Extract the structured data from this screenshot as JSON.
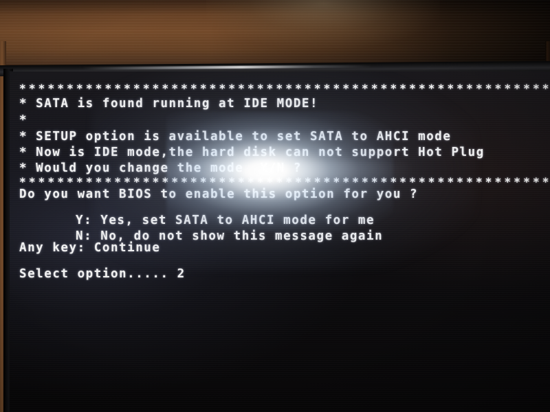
{
  "photo": {
    "subject": "monitor-bios-screen",
    "background_wall_color": "#6d4527",
    "bezel_color": "#1a1a1c",
    "screen_bg_color": "#0b0a0c",
    "text_color": "#f2f2f2",
    "glare_note": "bright lens flare obscures part of three text lines"
  },
  "bios": {
    "rule_top": "*********************************************************************",
    "lines": [
      {
        "id": "line-sata-mode",
        "text": "* SATA is found running at IDE MODE!"
      },
      {
        "id": "line-blank-star",
        "text": "*"
      },
      {
        "id": "line-setup",
        "text": "* SETUP option is available to set SATA to AHCI mode"
      },
      {
        "id": "line-hotplug",
        "text": "* Now is IDE mode,the hard disk can not support Hot Plug"
      },
      {
        "id": "line-change",
        "text": "* Would you change the mode  Y/N ?"
      }
    ],
    "rule_bottom": "*********************************************************************",
    "question": "Do you want BIOS to enable this option for you ?",
    "options": [
      {
        "key": "Y",
        "text": "Y: Yes, set SATA to AHCI mode for me"
      },
      {
        "key": "N",
        "text": "N: No, do not show this message again"
      },
      {
        "key": "Any key",
        "text": "Any key: Continue"
      }
    ],
    "prompt_label": "Select option.....",
    "prompt_value": "2",
    "prompt_full": "Select option..... 2"
  }
}
